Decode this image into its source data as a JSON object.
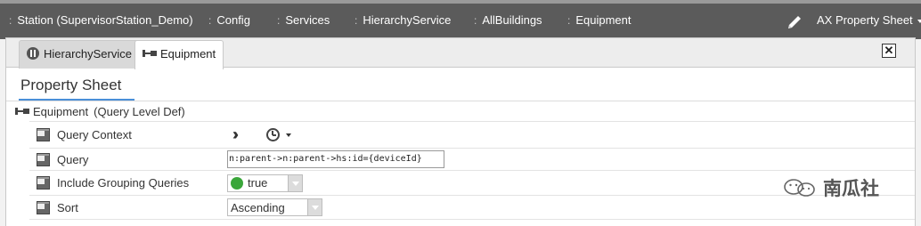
{
  "nav": {
    "breadcrumbs": [
      {
        "label": "Station (SupervisorStation_Demo)"
      },
      {
        "label": "Config"
      },
      {
        "label": "Services"
      },
      {
        "label": "HierarchyService"
      },
      {
        "label": "AllBuildings"
      },
      {
        "label": "Equipment"
      }
    ],
    "separator": ":",
    "view_selector": "AX Property Sheet"
  },
  "tabs": [
    {
      "label": "HierarchyService",
      "icon": "hierarchy-icon",
      "active": false
    },
    {
      "label": "Equipment",
      "icon": "equipment-icon",
      "active": true
    }
  ],
  "property_sheet": {
    "title": "Property Sheet",
    "root": {
      "name": "Equipment",
      "type": "(Query Level Def)"
    },
    "rows": {
      "query_context": {
        "label": "Query Context"
      },
      "query": {
        "label": "Query",
        "value": "n:parent->n:parent->hs:id={deviceId}"
      },
      "include_grouping": {
        "label": "Include Grouping Queries",
        "value": "true",
        "status_color": "#3aa63a"
      },
      "sort": {
        "label": "Sort",
        "value": "Ascending"
      }
    }
  },
  "watermark": {
    "text": "南瓜社"
  },
  "colors": {
    "navbar": "#5b5b5b",
    "accent": "#4a8fd8",
    "true_dot": "#3aa63a"
  }
}
